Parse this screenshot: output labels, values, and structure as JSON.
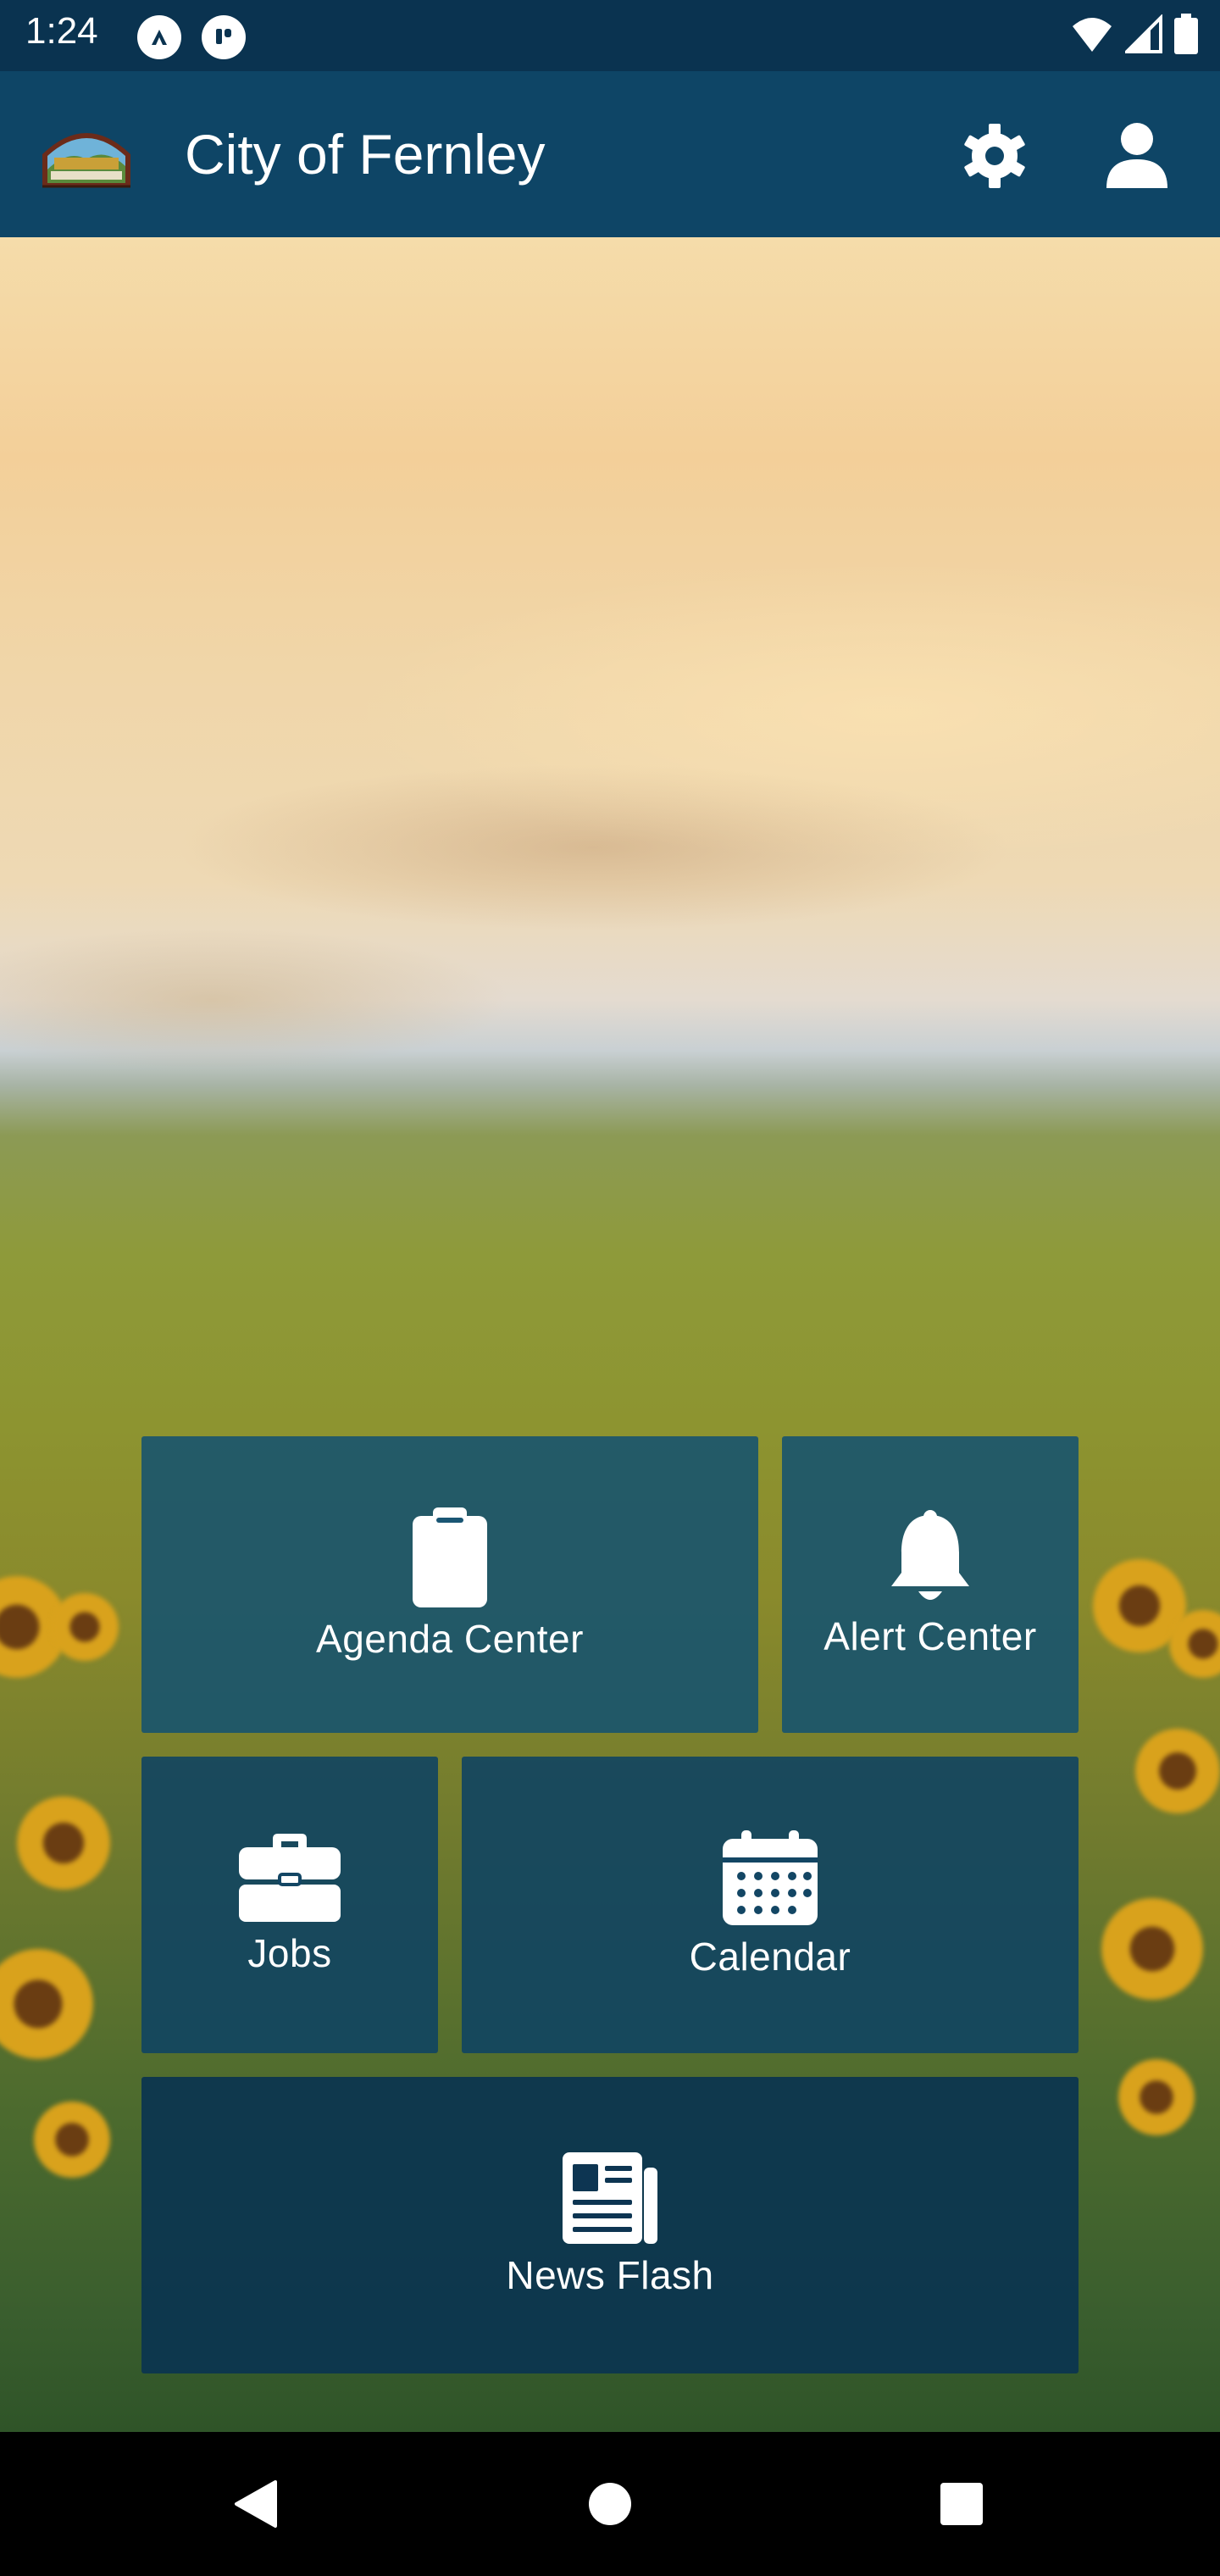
{
  "status_bar": {
    "time": "1:24",
    "icons": [
      "app-notification-icon",
      "notification-icon",
      "wifi-icon",
      "cell-signal-icon",
      "battery-icon"
    ]
  },
  "app_bar": {
    "title": "City of Fernley",
    "settings_icon": "gear-icon",
    "profile_icon": "person-icon",
    "background_color": "#0e4566"
  },
  "tiles": [
    {
      "label": "Agenda Center",
      "icon": "clipboard-icon"
    },
    {
      "label": "Alert Center",
      "icon": "bell-icon"
    },
    {
      "label": "Jobs",
      "icon": "briefcase-icon"
    },
    {
      "label": "Calendar",
      "icon": "calendar-icon"
    },
    {
      "label": "News Flash",
      "icon": "newspaper-icon"
    }
  ],
  "nav_bar": {
    "icons": [
      "back-icon",
      "home-icon",
      "recents-icon"
    ]
  },
  "colors": {
    "status_bar": "#0a3350",
    "tile_top": "#1a5674",
    "tile_bottom": "#0d3552"
  }
}
